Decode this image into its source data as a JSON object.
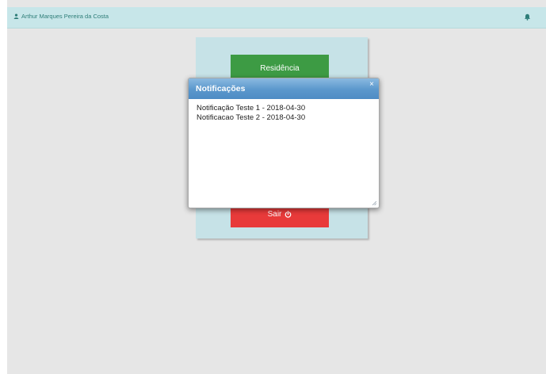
{
  "header": {
    "user_name": "Arthur Marques Pereira da Costa",
    "user_icon": "user-icon",
    "bell_icon": "bell-icon"
  },
  "menu": {
    "residence_label": "Residência",
    "logout_label": "Sair",
    "logout_icon": "power-icon"
  },
  "modal": {
    "title": "Notificações",
    "close_label": "×",
    "items": [
      "Notificação Teste 1 - 2018-04-30",
      "Notificacao Teste 2 - 2018-04-30"
    ]
  },
  "colors": {
    "topbar": "#c7e6e9",
    "panel": "#c6e2e7",
    "green_button": "#3d9b44",
    "red_button": "#e83a3a",
    "modal_header": "#5a97cc"
  }
}
